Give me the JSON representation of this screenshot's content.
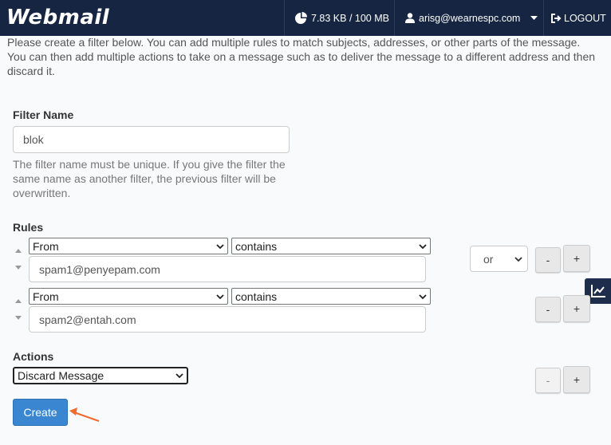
{
  "header": {
    "logo": "Webmail",
    "disk_usage": "7.83 KB / 100 MB",
    "user": "arisg@wearnespc.com",
    "logout": "LOGOUT"
  },
  "intro": "Please create a filter below. You can add multiple rules to match subjects, addresses, or other parts of the message. You can then add multiple actions to take on a message such as to deliver the message to a different address and then discard it.",
  "filter_name": {
    "label": "Filter Name",
    "value": "blok",
    "help": "The filter name must be unique. If you give the filter the same name as another filter, the previous filter will be overwritten."
  },
  "rules": {
    "label": "Rules",
    "items": [
      {
        "field": "From",
        "operator": "contains",
        "value": "spam1@penyepam.com"
      },
      {
        "field": "From",
        "operator": "contains",
        "value": "spam2@entah.com"
      }
    ],
    "conjunction": "or"
  },
  "actions": {
    "label": "Actions",
    "selected": "Discard Message"
  },
  "buttons": {
    "minus": "-",
    "plus": "+",
    "create": "Create"
  },
  "colors": {
    "topbar": "#162541",
    "primary": "#3b86d0",
    "annotation": "#f26a2e"
  }
}
